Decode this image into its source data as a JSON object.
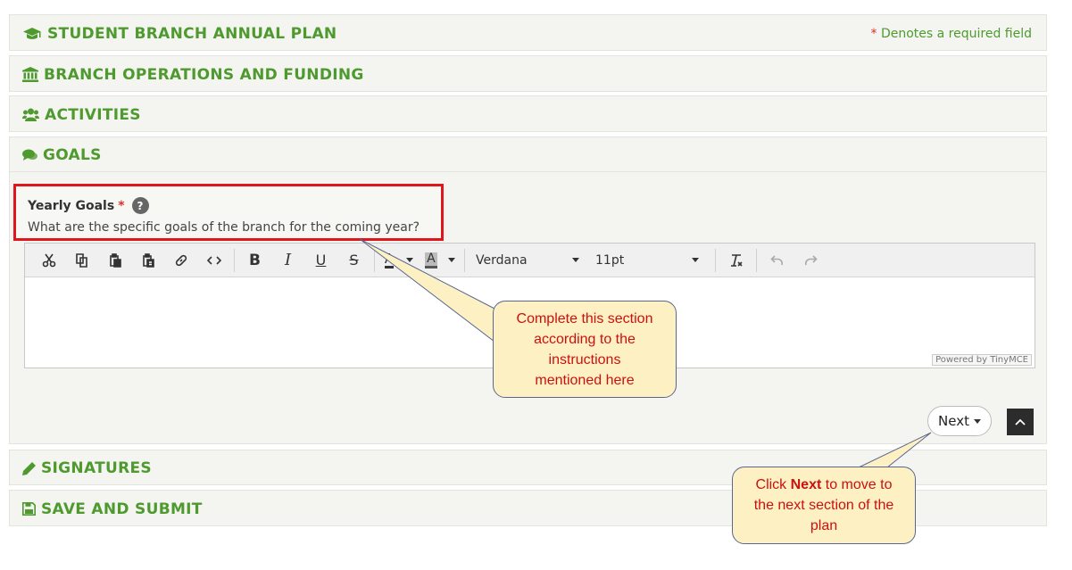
{
  "sections": {
    "annual_plan": "STUDENT BRANCH ANNUAL PLAN",
    "operations": "BRANCH OPERATIONS AND FUNDING",
    "activities": "ACTIVITIES",
    "goals": "GOALS",
    "signatures": "SIGNATURES",
    "save_submit": "SAVE AND SUBMIT"
  },
  "required_note": {
    "star": "*",
    "text": "Denotes a required field"
  },
  "field": {
    "label": "Yearly Goals",
    "required_star": "*",
    "help": "?",
    "description": "What are the specific goals of the branch for the coming year?"
  },
  "editor": {
    "font_family": "Verdana",
    "font_size": "11pt",
    "powered_by": "Powered by TinyMCE",
    "bold_label": "B",
    "italic_label": "I",
    "underline_label": "U",
    "strike_label": "S",
    "text_color_label": "A",
    "bg_color_label": "A",
    "icons": [
      "cut-icon",
      "copy-icon",
      "paste-icon",
      "paste-text-icon",
      "link-icon",
      "code-icon",
      "clear-format-icon",
      "undo-icon",
      "redo-icon"
    ]
  },
  "nav": {
    "next_label": "Next"
  },
  "callouts": {
    "instructions": [
      "Complete this section",
      "according to the",
      "instructions",
      "mentioned here"
    ],
    "next_prefix": "Click ",
    "next_bold": "Next",
    "next_suffix": " to move to",
    "next_line2": "the next section of the",
    "next_line3": "plan"
  },
  "colors": {
    "section_header": "#4e9a2e",
    "required": "#d9302c",
    "highlight_border": "#e0161c",
    "callout_bg": "#fdf1c4",
    "callout_text": "#cc1010"
  }
}
